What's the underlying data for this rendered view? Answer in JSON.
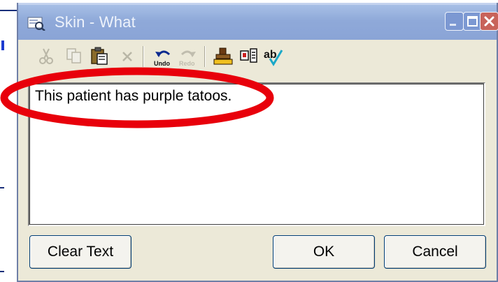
{
  "window": {
    "title": "Skin - What",
    "title_icon": "dictation-icon",
    "controls": [
      "minimize",
      "maximize",
      "close"
    ]
  },
  "toolbar": {
    "items": [
      {
        "name": "cut",
        "icon": "scissors-icon",
        "enabled": false
      },
      {
        "name": "copy",
        "icon": "copy-icon",
        "enabled": false
      },
      {
        "name": "paste",
        "icon": "clipboard-icon",
        "enabled": true
      },
      {
        "name": "delete",
        "icon": "x-icon",
        "enabled": false
      },
      {
        "name": "undo",
        "icon": "undo-icon",
        "label": "Undo",
        "enabled": true
      },
      {
        "name": "redo",
        "icon": "redo-icon",
        "label": "Redo",
        "enabled": false
      },
      {
        "name": "stamp",
        "icon": "stamp-icon",
        "enabled": true
      },
      {
        "name": "template",
        "icon": "template-icon",
        "enabled": true
      },
      {
        "name": "spellcheck",
        "icon": "spellcheck-icon",
        "label": "ab",
        "enabled": true
      }
    ]
  },
  "text_field": {
    "value": "This patient has purple tatoos."
  },
  "buttons": {
    "clear": "Clear Text",
    "ok": "OK",
    "cancel": "Cancel"
  },
  "colors": {
    "titlebar": "#8fa9d9",
    "dialog_bg": "#ece9d8",
    "annotation": "#e8000b"
  }
}
